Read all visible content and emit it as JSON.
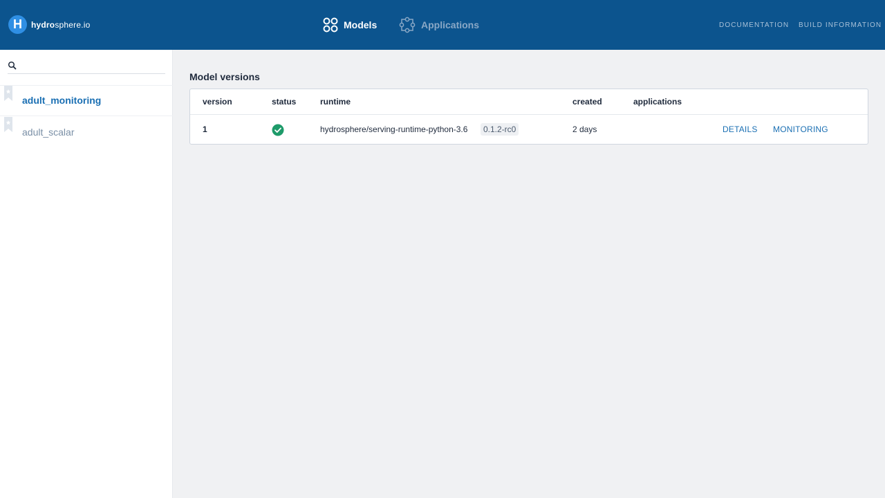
{
  "header": {
    "logo_letter": "H",
    "logo_bold": "hydro",
    "logo_rest": "sphere.io",
    "nav": [
      {
        "label": "Models",
        "icon": "models-icon"
      },
      {
        "label": "Applications",
        "icon": "applications-icon"
      }
    ],
    "links": [
      "DOCUMENTATION",
      "BUILD INFORMATION"
    ]
  },
  "sidebar": {
    "search": {
      "value": "",
      "placeholder": ""
    },
    "models": [
      {
        "name": "adult_monitoring",
        "active": true
      },
      {
        "name": "adult_scalar",
        "active": false
      }
    ]
  },
  "main": {
    "title": "Model versions",
    "columns": [
      "version",
      "status",
      "runtime",
      "created",
      "applications"
    ],
    "rows": [
      {
        "version": "1",
        "status": "success",
        "runtime": "hydrosphere/serving-runtime-python-3.6",
        "runtime_tag": "0.1.2-rc0",
        "created": "2 days",
        "applications": "",
        "actions": [
          "DETAILS",
          "MONITORING"
        ]
      }
    ]
  },
  "colors": {
    "header_bg": "#0c548e",
    "accent": "#1a6fb3",
    "success": "#1e9b6a"
  }
}
